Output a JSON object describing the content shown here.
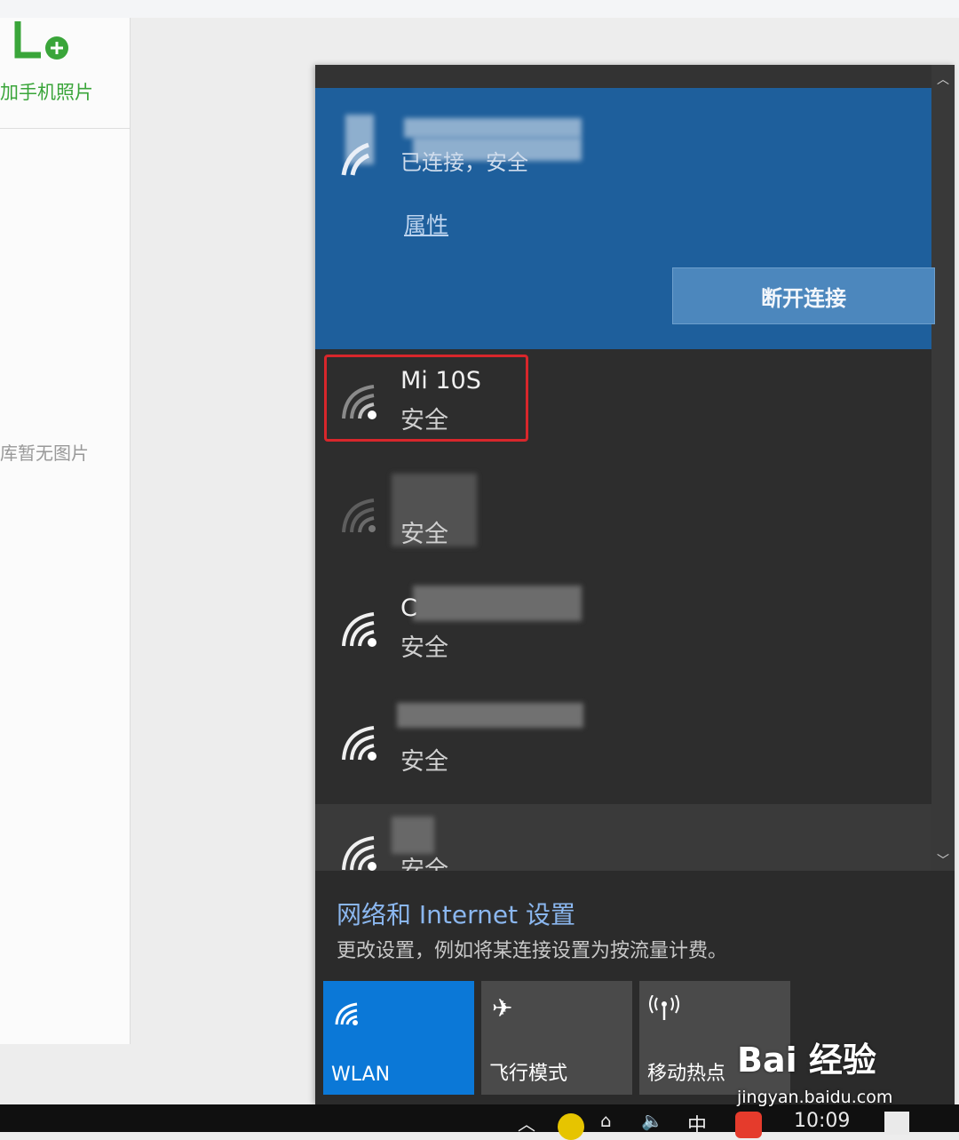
{
  "left_panel": {
    "add_photos_label": "加手机照片",
    "empty_label": "库暂无图片"
  },
  "connected": {
    "status": "已连接，安全",
    "properties_link": "属性",
    "disconnect_label": "断开连接"
  },
  "networks": [
    {
      "name": "Mi 10S",
      "security": "安全",
      "highlighted": true
    },
    {
      "name": "",
      "security": "安全"
    },
    {
      "name": "C",
      "security": "安全"
    },
    {
      "name": "",
      "security": "安全"
    },
    {
      "name": "",
      "security": "安全"
    }
  ],
  "settings": {
    "title": "网络和 Internet 设置",
    "description": "更改设置，例如将某连接设置为按流量计费。"
  },
  "tiles": [
    {
      "label": "WLAN",
      "icon": "wifi-icon",
      "active": true
    },
    {
      "label": "飞行模式",
      "icon": "airplane-icon",
      "active": false
    },
    {
      "label": "移动热点",
      "icon": "hotspot-icon",
      "active": false
    }
  ],
  "taskbar": {
    "ime": "中",
    "time": "10:09"
  },
  "watermark": {
    "logo": "Bai 经验",
    "url": "jingyan.baidu.com"
  },
  "colors": {
    "accent": "#0b78d7",
    "connected_bg": "#1e5f9c",
    "highlight": "#d8262b",
    "green": "#3aa53a"
  }
}
